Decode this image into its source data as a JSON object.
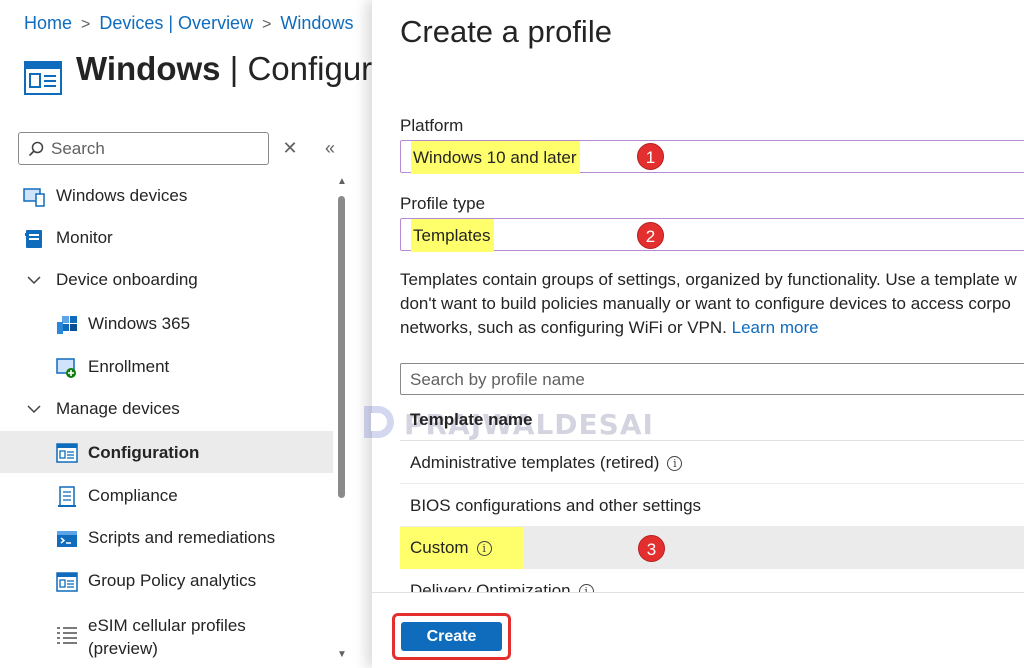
{
  "breadcrumb": {
    "items": [
      "Home",
      "Devices | Overview",
      "Windows"
    ]
  },
  "header": {
    "title_bold": "Windows",
    "title_rest": " | Configura"
  },
  "sidebar": {
    "search_placeholder": "Search",
    "close_glyph": "✕",
    "collapse_glyph": "«",
    "items": [
      {
        "label": "Windows devices",
        "icon": "windows-devices-icon"
      },
      {
        "label": "Monitor",
        "icon": "monitor-icon"
      },
      {
        "label": "Device onboarding",
        "icon": "chevron-down-icon",
        "group": true
      },
      {
        "label": "Windows 365",
        "icon": "windows365-icon"
      },
      {
        "label": "Enrollment",
        "icon": "enrollment-icon"
      },
      {
        "label": "Manage devices",
        "icon": "chevron-down-icon",
        "group": true
      },
      {
        "label": "Configuration",
        "icon": "configuration-icon",
        "selected": true
      },
      {
        "label": "Compliance",
        "icon": "compliance-icon"
      },
      {
        "label": "Scripts and remediations",
        "icon": "scripts-icon"
      },
      {
        "label": "Group Policy analytics",
        "icon": "group-policy-icon"
      },
      {
        "label": "eSIM cellular profiles",
        "label2": "(preview)",
        "icon": "esim-icon"
      }
    ]
  },
  "panel": {
    "title": "Create a profile",
    "platform_label": "Platform",
    "platform_value": "Windows 10 and later",
    "profile_type_label": "Profile type",
    "profile_type_value": "Templates",
    "description_lines": [
      "Templates contain groups of settings, organized by functionality. Use a template w",
      "don't want to build policies manually or want to configure devices to access corpo",
      "networks, such as configuring WiFi or VPN. "
    ],
    "learn_more": "Learn more",
    "search_placeholder": "Search by profile name",
    "table_header": "Template name",
    "templates": [
      {
        "name": "Administrative templates (retired)",
        "info": true
      },
      {
        "name": "BIOS configurations and other settings",
        "info": false
      },
      {
        "name": "Custom",
        "info": true,
        "selected": true
      },
      {
        "name": "Delivery Optimization",
        "info": true
      }
    ],
    "create_label": "Create",
    "info_glyph": "i"
  },
  "annotations": [
    "1",
    "2",
    "3"
  ],
  "watermark": "PRAJWALDESAI",
  "colors": {
    "accent": "#0f6cbd",
    "highlight": "#ffff6b",
    "badge": "#e3302f",
    "selected_bg": "#ebebeb"
  }
}
